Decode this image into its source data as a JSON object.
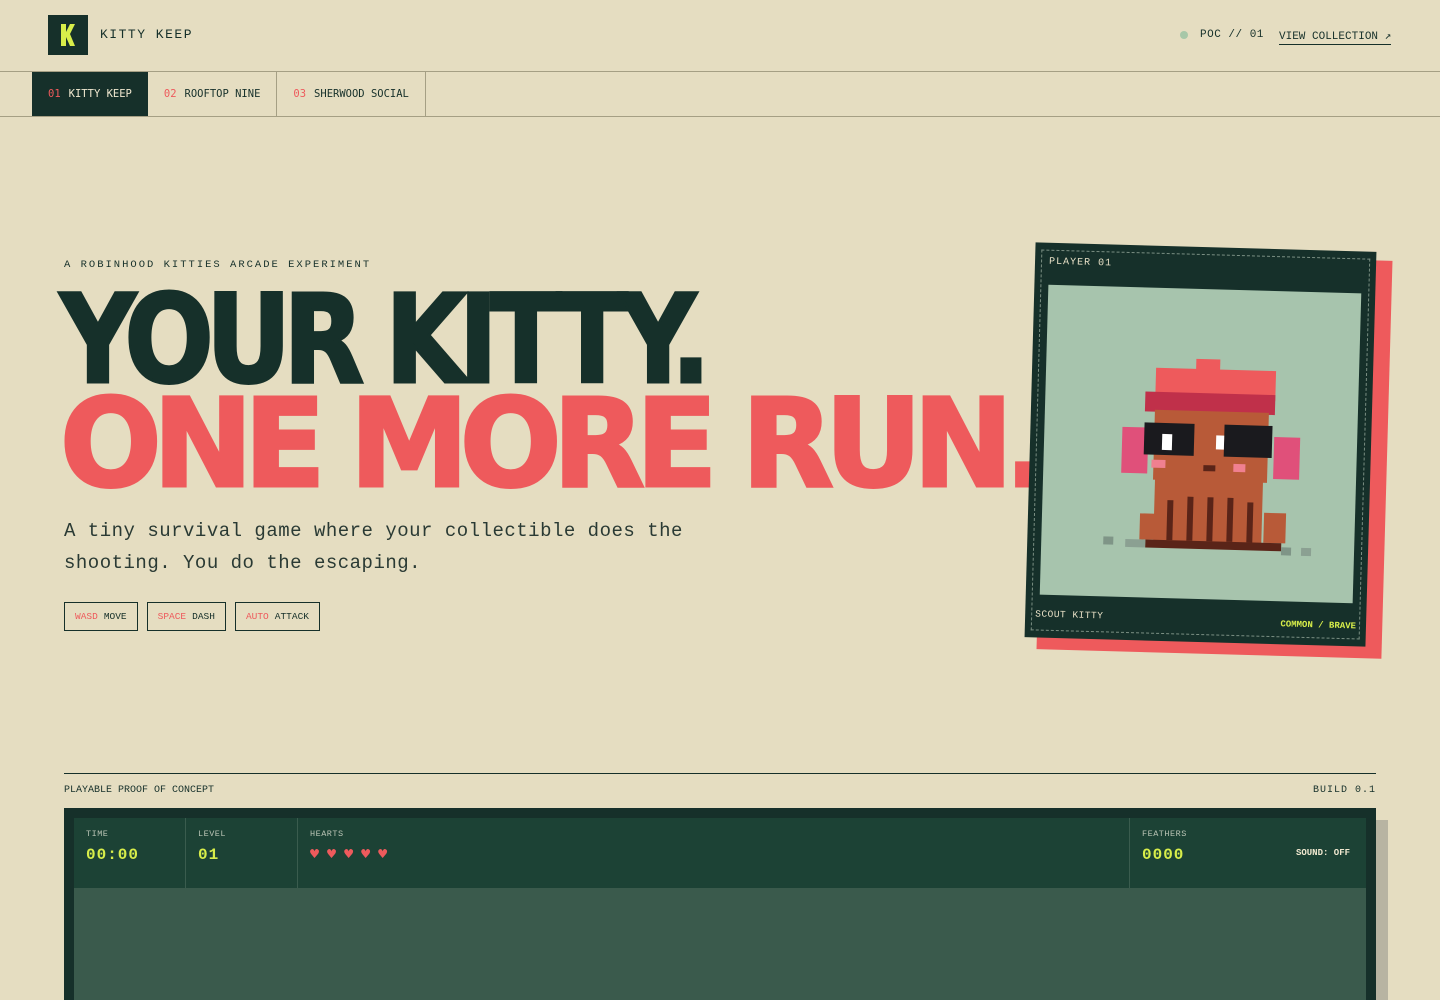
{
  "header": {
    "brand": "KITTY KEEP",
    "status": "POC // 01",
    "view_collection": "VIEW COLLECTION ↗"
  },
  "tabs": [
    {
      "num": "01",
      "label": "KITTY KEEP",
      "active": true
    },
    {
      "num": "02",
      "label": "ROOFTOP NINE",
      "active": false
    },
    {
      "num": "03",
      "label": "SHERWOOD SOCIAL",
      "active": false
    }
  ],
  "hero": {
    "eyebrow": "A ROBINHOOD KITTIES ARCADE EXPERIMENT",
    "headline_1": "YOUR KITTY.",
    "headline_2": "ONE MORE RUN.",
    "subtitle": "A tiny survival game where your collectible does the shooting. You do the escaping.",
    "controls": [
      {
        "key": "WASD",
        "action": "MOVE"
      },
      {
        "key": "SPACE",
        "action": "DASH"
      },
      {
        "key": "AUTO",
        "action": "ATTACK"
      }
    ]
  },
  "card": {
    "label": "PLAYER 01",
    "name": "SCOUT KITTY",
    "rarity": "COMMON / BRAVE"
  },
  "game": {
    "section_label": "PLAYABLE PROOF OF CONCEPT",
    "build": "BUILD 0.1",
    "hud": {
      "time_label": "TIME",
      "time": "00:00",
      "level_label": "LEVEL",
      "level": "01",
      "hearts_label": "HEARTS",
      "hearts": [
        "♥",
        "♥",
        "♥",
        "♥",
        "♥"
      ],
      "feathers_label": "FEATHERS",
      "feathers": "0000",
      "sound": "SOUND: OFF"
    }
  },
  "colors": {
    "background": "#e5ddc1",
    "dark_green": "#16302a",
    "coral": "#ee5a5c",
    "lime": "#d8ee4a",
    "sage": "#a7c4ad"
  }
}
